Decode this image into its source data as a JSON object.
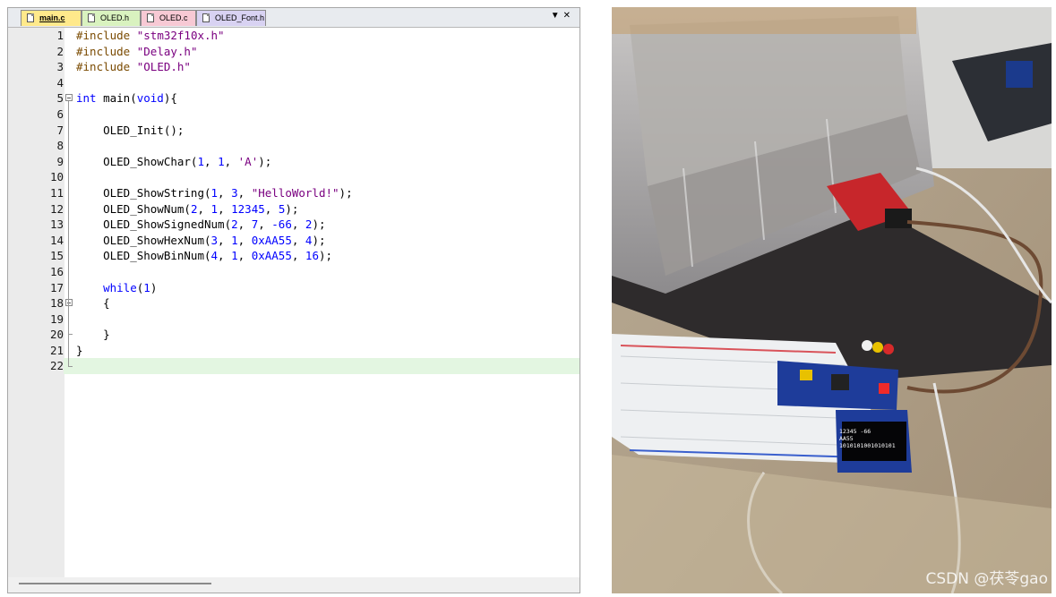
{
  "editor": {
    "tabs": [
      {
        "label": "main.c",
        "active": true
      },
      {
        "label": "OLED.h",
        "active": false
      },
      {
        "label": "OLED.c",
        "active": false
      },
      {
        "label": "OLED_Font.h",
        "active": false
      }
    ],
    "tab_menu_icon": "dropdown-arrow-icon",
    "tab_close_icon": "close-icon",
    "lines": [
      {
        "n": "1",
        "html": "<span class=\"pp\">#include</span> <span class=\"st\">\"stm32f10x.h\"</span>"
      },
      {
        "n": "2",
        "html": "<span class=\"pp\">#include</span> <span class=\"st\">\"Delay.h\"</span>"
      },
      {
        "n": "3",
        "html": "<span class=\"pp\">#include</span> <span class=\"st\">\"OLED.h\"</span>"
      },
      {
        "n": "4",
        "html": ""
      },
      {
        "n": "5",
        "html": "<span class=\"kw\">int</span> main(<span class=\"kw\">void</span>){"
      },
      {
        "n": "6",
        "html": ""
      },
      {
        "n": "7",
        "html": "    OLED_Init();"
      },
      {
        "n": "8",
        "html": ""
      },
      {
        "n": "9",
        "html": "    OLED_ShowChar(<span class=\"nm\">1</span>, <span class=\"nm\">1</span>, <span class=\"ch\">'A'</span>);"
      },
      {
        "n": "10",
        "html": ""
      },
      {
        "n": "11",
        "html": "    OLED_ShowString(<span class=\"nm\">1</span>, <span class=\"nm\">3</span>, <span class=\"st\">\"HelloWorld!\"</span>);"
      },
      {
        "n": "12",
        "html": "    OLED_ShowNum(<span class=\"nm\">2</span>, <span class=\"nm\">1</span>, <span class=\"nm\">12345</span>, <span class=\"nm\">5</span>);"
      },
      {
        "n": "13",
        "html": "    OLED_ShowSignedNum(<span class=\"nm\">2</span>, <span class=\"nm\">7</span>, <span class=\"nm\">-66</span>, <span class=\"nm\">2</span>);"
      },
      {
        "n": "14",
        "html": "    OLED_ShowHexNum(<span class=\"nm\">3</span>, <span class=\"nm\">1</span>, <span class=\"nm\">0xAA55</span>, <span class=\"nm\">4</span>);"
      },
      {
        "n": "15",
        "html": "    OLED_ShowBinNum(<span class=\"nm\">4</span>, <span class=\"nm\">1</span>, <span class=\"nm\">0xAA55</span>, <span class=\"nm\">16</span>);"
      },
      {
        "n": "16",
        "html": ""
      },
      {
        "n": "17",
        "html": "    <span class=\"kw\">while</span>(<span class=\"nm\">1</span>)"
      },
      {
        "n": "18",
        "html": "    {"
      },
      {
        "n": "19",
        "html": ""
      },
      {
        "n": "20",
        "html": "    }"
      },
      {
        "n": "21",
        "html": "}"
      },
      {
        "n": "22",
        "html": ""
      }
    ],
    "active_line": "22"
  },
  "photo": {
    "watermark": "CSDN @茯苓gao",
    "oled_display_lines": [
      "12345 -66",
      "AA55",
      "1010101001010101"
    ]
  }
}
